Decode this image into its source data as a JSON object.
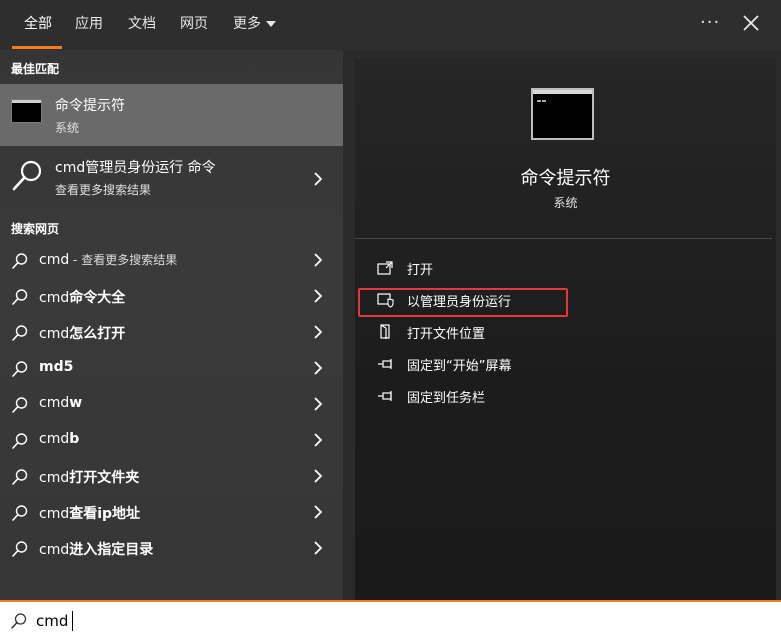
{
  "tabs": [
    {
      "label": "全部"
    },
    {
      "label": "应用"
    },
    {
      "label": "文档"
    },
    {
      "label": "网页"
    },
    {
      "label": "更多"
    }
  ],
  "best_match": {
    "section": "最佳匹配",
    "name": "命令提示符",
    "sub": "系统"
  },
  "more_results": {
    "name": "cmd管理员身份运行 命令",
    "sub": "查看更多搜索结果"
  },
  "web": {
    "section": "搜索网页",
    "items": [
      {
        "prefix": "cmd",
        "bold": "",
        "hint": " - 查看更多搜索结果"
      },
      {
        "prefix": "cmd",
        "bold": "命令大全",
        "hint": ""
      },
      {
        "prefix": "cmd",
        "bold": "怎么打开",
        "hint": ""
      },
      {
        "prefix": "",
        "bold": "md5",
        "hint": ""
      },
      {
        "prefix": "cmd",
        "bold": "w",
        "hint": ""
      },
      {
        "prefix": "cmd",
        "bold": "b",
        "hint": ""
      },
      {
        "prefix": "cmd",
        "bold": "打开文件夹",
        "hint": ""
      },
      {
        "prefix": "cmd",
        "bold": "查看ip地址",
        "hint": ""
      },
      {
        "prefix": "cmd",
        "bold": "进入指定目录",
        "hint": ""
      }
    ]
  },
  "preview": {
    "name": "命令提示符",
    "sub": "系统",
    "actions": [
      {
        "label": "打开",
        "icon": "open-icon"
      },
      {
        "label": "以管理员身份运行",
        "icon": "shield-icon"
      },
      {
        "label": "打开文件位置",
        "icon": "file-location-icon"
      },
      {
        "label": "固定到“开始”屏幕",
        "icon": "pin-icon"
      },
      {
        "label": "固定到任务栏",
        "icon": "pin-icon"
      }
    ]
  },
  "search": {
    "value": "cmd"
  },
  "colors": {
    "accent": "#f57c20",
    "highlight": "#e23a3a"
  }
}
